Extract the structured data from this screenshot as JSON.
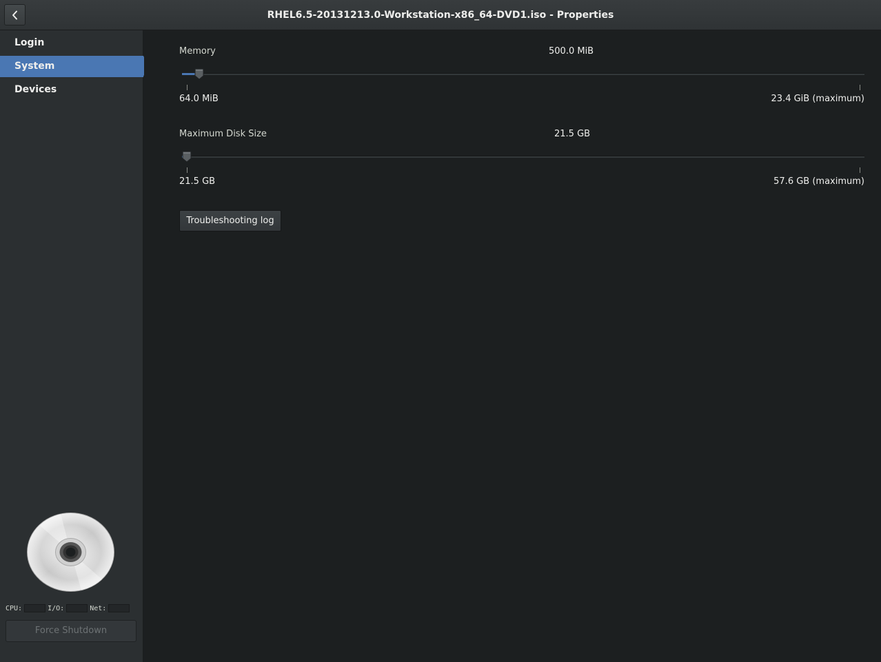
{
  "header": {
    "title": "RHEL6.5-20131213.0-Workstation-x86_64-DVD1.iso - Properties",
    "back_icon": "chevron-left-icon"
  },
  "sidebar": {
    "items": [
      {
        "label": "Login",
        "selected": false
      },
      {
        "label": "System",
        "selected": true
      },
      {
        "label": "Devices",
        "selected": false
      }
    ],
    "disc_icon": "optical-disc-icon",
    "stats": {
      "cpu_label": "CPU:",
      "io_label": "I/O:",
      "net_label": "Net:"
    },
    "force_shutdown_label": "Force Shutdown"
  },
  "system": {
    "memory": {
      "label": "Memory",
      "value": "500.0 MiB",
      "min_label": "64.0 MiB",
      "max_label": "23.4 GiB (maximum)",
      "level_fraction": 0.018
    },
    "disk": {
      "label": "Maximum Disk Size",
      "value": "21.5 GB",
      "min_label": "21.5 GB",
      "max_label": "57.6 GB (maximum)",
      "level_fraction": 0.0
    },
    "troubleshooting_label": "Troubleshooting log"
  },
  "colors": {
    "accent": "#4a77b3",
    "background": "#1c1f20",
    "sidebar": "#2b2f31"
  }
}
